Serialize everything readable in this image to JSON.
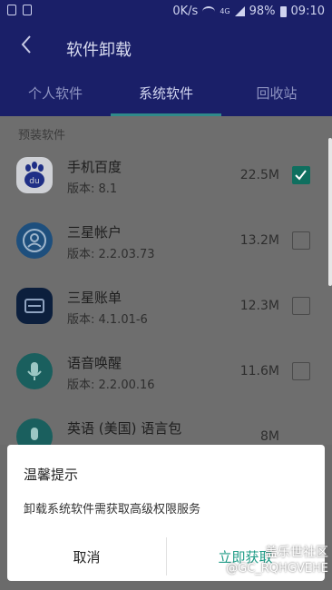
{
  "status": {
    "net_speed": "0K/s",
    "network_type": "4G",
    "battery": "98%",
    "time": "09:10"
  },
  "header": {
    "title": "软件卸载"
  },
  "tabs": [
    {
      "label": "个人软件",
      "active": false
    },
    {
      "label": "系统软件",
      "active": true
    },
    {
      "label": "回收站",
      "active": false
    }
  ],
  "section": {
    "label": "预装软件"
  },
  "apps": [
    {
      "name": "手机百度",
      "version": "版本: 8.1",
      "size": "22.5M",
      "checked": true,
      "icon": "baidu-icon",
      "icon_text": "du"
    },
    {
      "name": "三星帐户",
      "version": "版本: 2.2.03.73",
      "size": "13.2M",
      "checked": false,
      "icon": "samsung-account-icon"
    },
    {
      "name": "三星账单",
      "version": "版本: 4.1.01-6",
      "size": "12.3M",
      "checked": false,
      "icon": "samsung-bill-icon"
    },
    {
      "name": "语音唤醒",
      "version": "版本: 2.2.00.16",
      "size": "11.6M",
      "checked": false,
      "icon": "voice-wakeup-icon"
    },
    {
      "name": "英语 (美国) 语言包",
      "version": "",
      "size": "8M",
      "checked": false,
      "icon": "language-pack-icon"
    }
  ],
  "dialog": {
    "title": "温馨提示",
    "message": "卸载系统软件需获取高级权限服务",
    "cancel": "取消",
    "confirm": "立即获取"
  },
  "watermark": {
    "line1": "盖乐世社区",
    "line2": "@GC_RQHGVEHE"
  },
  "colors": {
    "accent": "#1e9b86",
    "checkbox_checked": "#0f6f5f",
    "header_bg": "#1a1f68"
  }
}
